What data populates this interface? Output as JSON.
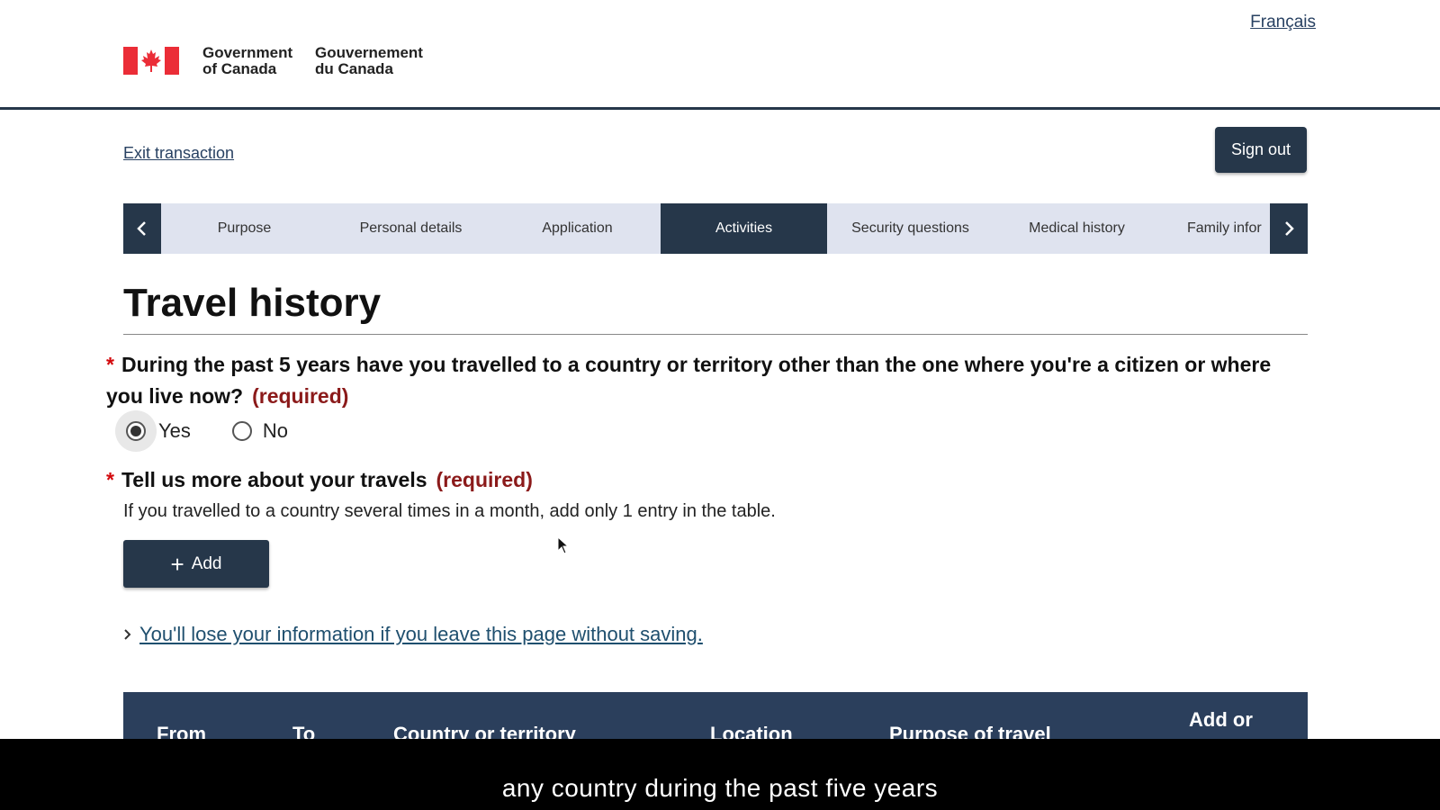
{
  "header": {
    "gov_en_line1": "Government",
    "gov_en_line2": "of Canada",
    "gov_fr_line1": "Gouvernement",
    "gov_fr_line2": "du Canada",
    "language_link": "Français",
    "flag_icon": "canada-flag-icon"
  },
  "toolbar": {
    "exit_label": "Exit transaction",
    "signout_label": "Sign out"
  },
  "stepnav": {
    "prev_icon": "chevron-left-icon",
    "next_icon": "chevron-right-icon",
    "steps": [
      {
        "label": "Purpose",
        "active": false
      },
      {
        "label": "Personal details",
        "active": false
      },
      {
        "label": "Application",
        "active": false
      },
      {
        "label": "Activities",
        "active": true
      },
      {
        "label": "Security questions",
        "active": false
      },
      {
        "label": "Medical history",
        "active": false
      },
      {
        "label": "Family infor",
        "active": false
      }
    ]
  },
  "main": {
    "title": "Travel history",
    "q1": {
      "text": "During the past 5 years have you travelled to a country or territory other than the one where you're a citizen or where you live now?",
      "required": "(required)",
      "options": [
        {
          "label": "Yes",
          "selected": true
        },
        {
          "label": "No",
          "selected": false
        }
      ]
    },
    "q2": {
      "text": "Tell us more about your travels",
      "required": "(required)",
      "hint": "If you travelled to a country several times in a month, add only 1 entry in the table."
    },
    "add_label": "Add",
    "details_link": "You'll lose your information if you leave this page without saving.",
    "table_headers": [
      "From",
      "To",
      "Country or territory",
      "Location",
      "Purpose of travel",
      "Add or"
    ]
  },
  "caption": "any country during the past five years",
  "colors": {
    "primary": "#26374a",
    "required": "#8b1a1a",
    "asterisk": "#d3080c",
    "link": "#284162",
    "nav_bg": "#dfe3ef"
  }
}
